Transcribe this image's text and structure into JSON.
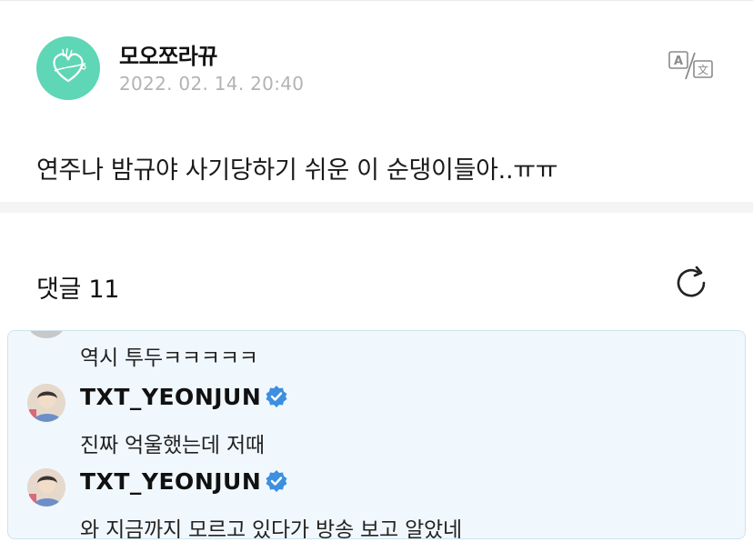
{
  "post": {
    "author": "모오쪼라뀨",
    "date": "2022. 02. 14. 20:40",
    "body": "연주나 밤규야 사기당하기 쉬운 이 순댕이들아..ㅠㅠ",
    "translate_icon": "translate-icon"
  },
  "comments": {
    "title": "댓글 11",
    "refresh_icon": "refresh-icon",
    "items": [
      {
        "text": "역시 투두ㅋㅋㅋㅋㅋ"
      },
      {
        "author": "TXT_YEONJUN",
        "verified": true,
        "text": "진짜 억울했는데 저때"
      },
      {
        "author": "TXT_YEONJUN",
        "verified": true,
        "text": "와 지금까지 모르고 있다가 방송 보고 알았네"
      }
    ]
  },
  "colors": {
    "avatar_bg": "#5fd6b5",
    "date": "#b3b3b3",
    "verified": "#3d8fe0",
    "comment_bg": "#f1f8fd",
    "comment_border": "#cfe3ef"
  }
}
